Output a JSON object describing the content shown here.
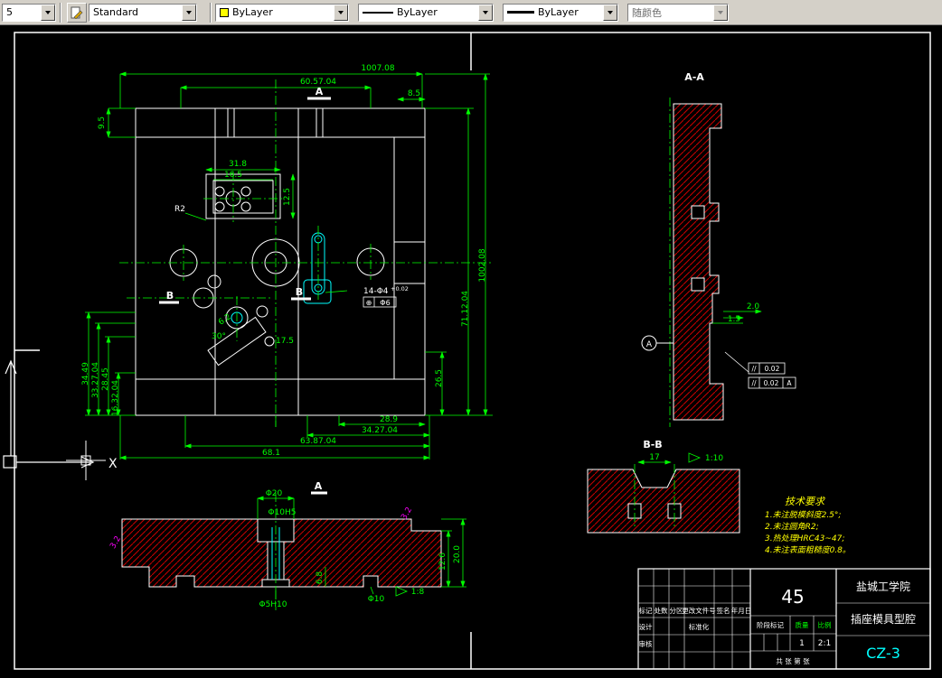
{
  "toolbar": {
    "layer_value": "5",
    "text_style_value": "Standard",
    "color_value": "ByLayer",
    "linetype_value": "ByLayer",
    "lineweight_value": "ByLayer",
    "plot_style_value": "随颜色"
  },
  "plan_view": {
    "section_label_top": "A",
    "section_label_b1": "B",
    "section_label_b2": "B",
    "dim_total_width": "1007.08",
    "dim_inner_width": "60.57.04",
    "dim_right_offset": "8.5",
    "dim_left_offset": "9.5",
    "dim_block_width": "31.8",
    "dim_block_inner": "16.5",
    "dim_block_height": "12.5",
    "radius_label": "R2",
    "dim_left_1": "34.49",
    "dim_left_2": "33.27.04",
    "dim_left_3": "28.45",
    "dim_left_4": "16.32.04",
    "dim_right_1": "1002.08",
    "dim_right_2": "71.12.04",
    "dim_right_3": "26.5",
    "dim_bottom_1": "28.9",
    "dim_bottom_2": "34.27.04",
    "dim_bottom_3": "63.87.04",
    "dim_bottom_4": "68.1",
    "holes_note": "14-Φ4",
    "holes_tol": "+0.02",
    "holes_frame_sym": "⊕",
    "holes_frame_val": "Φ6",
    "angle_label": "30°",
    "slot_width": "17.5",
    "slot_len": "6.2"
  },
  "section_aa": {
    "title": "A-A",
    "datum_label": "A",
    "dim_step_1": "1.5",
    "dim_step_2": "2.0",
    "gdt_1_sym": "//",
    "gdt_1_tol": "0.02",
    "gdt_2_sym": "//",
    "gdt_2_tol": "0.02",
    "gdt_2_datum": "A"
  },
  "section_bb": {
    "title": "B-B",
    "dim_width": "17",
    "taper_label": "1:10"
  },
  "front_section": {
    "section_label": "A",
    "dim_head": "Φ20",
    "dim_pin": "Φ10H5",
    "dim_hole_bottom": "Φ5H10",
    "dim_hole_right": "Φ10",
    "dim_depth_1": "20.0",
    "dim_depth_2": "12.6",
    "dim_stem": "6.8",
    "taper_label": "1:8",
    "finish_left": "3.2",
    "finish_right": "3.2"
  },
  "tech_notes": {
    "title": "技术要求",
    "line1": "1.未注脱模斜度2.5°;",
    "line2": "2.未注圆角R2;",
    "line3": "3.热处理HRC43~47;",
    "line4": "4.未注表面粗糙度0.8。"
  },
  "ucs": {
    "x_label": "X"
  },
  "title_block": {
    "material": "45",
    "company": "盐城工学院",
    "part_name": "插座模具型腔",
    "drawing_no": "CZ-3",
    "col_mark": "标记",
    "col_count": "处数",
    "col_zone": "分区",
    "col_change_doc": "更改文件号",
    "col_sign": "签名",
    "col_date": "年月日",
    "row_design": "设计",
    "row_standard": "标准化",
    "row_check": "审核",
    "stage_label": "阶段标记",
    "mass_label": "质量",
    "scale_label": "比例",
    "sheet_no": "1",
    "scale_value": "2:1",
    "sheet_label": "共 张 第 张"
  }
}
